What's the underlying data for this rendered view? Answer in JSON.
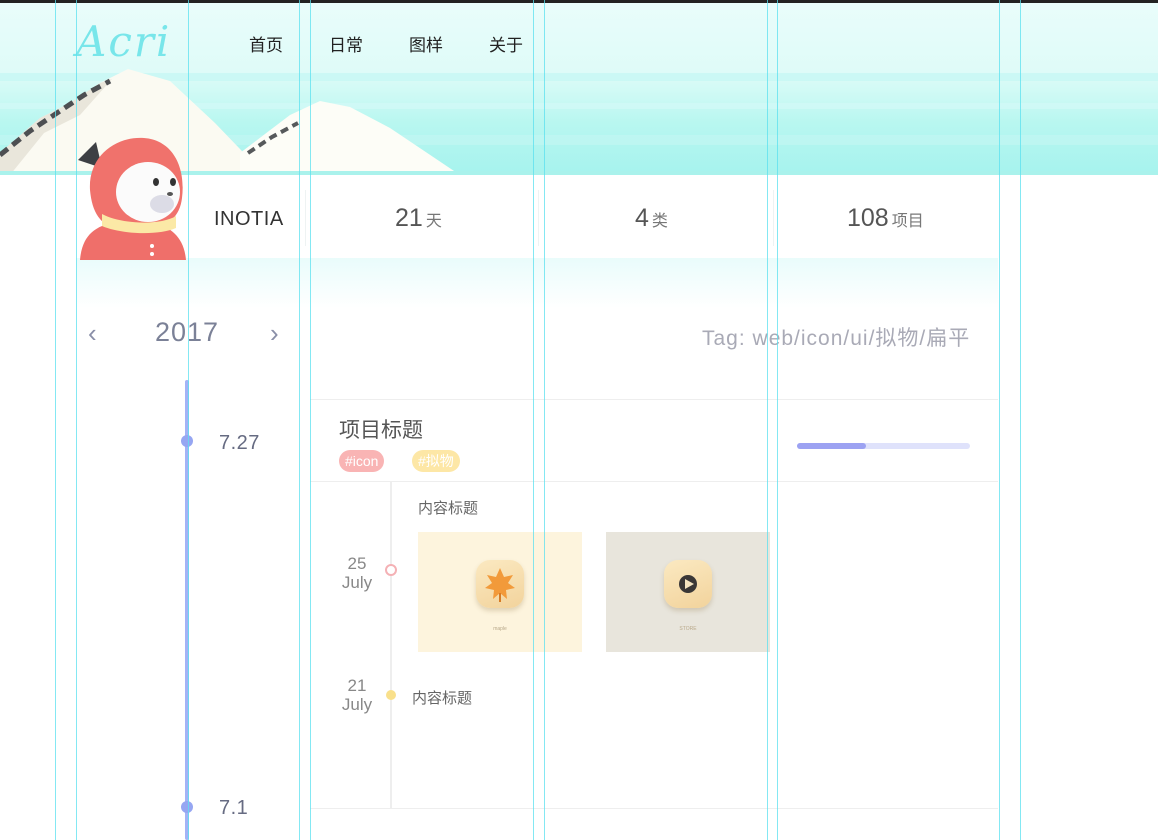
{
  "brand": {
    "logo": "Acri"
  },
  "nav": {
    "items": [
      "首页",
      "日常",
      "图样",
      "关于"
    ]
  },
  "profile": {
    "username": "INOTIA"
  },
  "stats": [
    {
      "value": "21",
      "unit": "天"
    },
    {
      "value": "4",
      "unit": "类"
    },
    {
      "value": "108",
      "unit": "项目"
    }
  ],
  "year_switcher": {
    "year": "2017",
    "prev": "‹",
    "next": "›"
  },
  "tag_line": "Tag: web/icon/ui/拟物/扁平",
  "timeline": {
    "dates": [
      "7.27",
      "7.1"
    ]
  },
  "project": {
    "title": "项目标题",
    "tags": [
      "#icon",
      "#拟物"
    ],
    "progress": 0.4,
    "entries": [
      {
        "day": "25",
        "month": "July",
        "title": "内容标题",
        "thumbs": [
          {
            "caption": "maple",
            "bg": "#fdf4dd"
          },
          {
            "caption": "STORE",
            "bg": "#e8e5dc"
          }
        ]
      },
      {
        "day": "21",
        "month": "July",
        "title": "内容标题"
      }
    ]
  },
  "colors": {
    "accent": "#96a6f2",
    "logo": "#78e6ea",
    "tag_pink": "#f9b4b4",
    "tag_yellow": "#fde7a6",
    "guide": "#5be0ef"
  }
}
